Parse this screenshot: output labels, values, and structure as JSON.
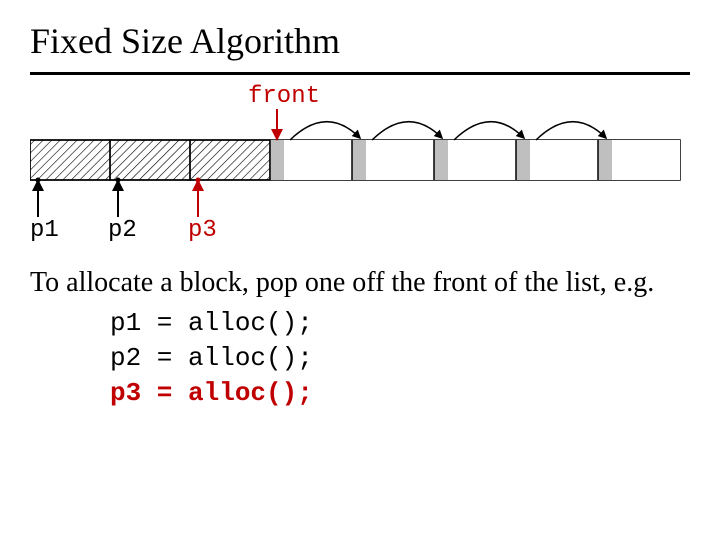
{
  "title": "Fixed Size Algorithm",
  "labels": {
    "front": "front",
    "p1": "p1",
    "p2": "p2",
    "p3": "p3"
  },
  "paragraph": "To allocate a block, pop one off the front of the list, e.g.",
  "code": {
    "line1": "p1 = alloc();",
    "line2": "p2 = alloc();",
    "line3": "p3 = alloc();"
  },
  "chart_data": {
    "type": "table",
    "blocks": [
      {
        "state": "allocated",
        "pointer": "p1"
      },
      {
        "state": "allocated",
        "pointer": "p2"
      },
      {
        "state": "allocated",
        "pointer": "p3"
      },
      {
        "state": "free",
        "front": true
      },
      {
        "state": "free"
      },
      {
        "state": "free"
      },
      {
        "state": "free"
      },
      {
        "state": "free"
      }
    ],
    "note": "free blocks form a singly-linked list via arcs; front points at first free block"
  }
}
